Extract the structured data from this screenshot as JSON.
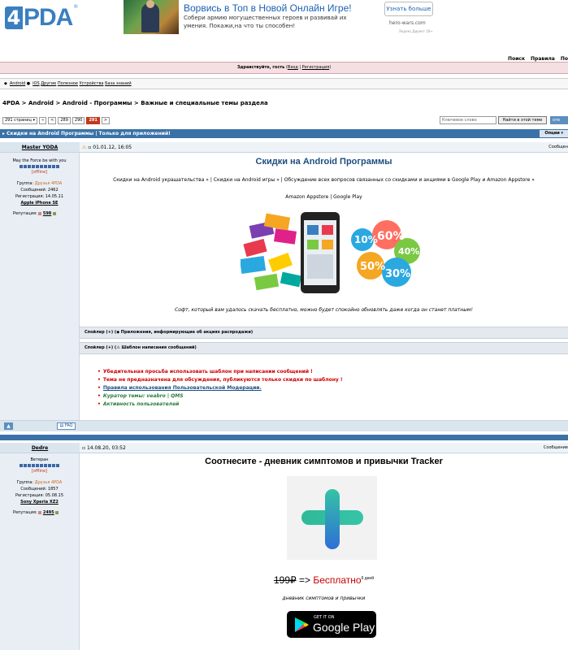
{
  "header": {
    "logo_text": "PDA",
    "logo_number": "4",
    "ad": {
      "title": "Ворвись в Топ в Новой Онлайн Игре!",
      "body": "Собери армию могущественных героев и развивай их умения. Покажи,на что ты способен!",
      "button": "Узнать больше",
      "domain": "hero-wars.com",
      "note": "Яндекс.Директ 18+"
    },
    "nav": [
      "Поиск",
      "Правила",
      "По"
    ]
  },
  "welcome": {
    "greeting": "Здравствуйте, гость",
    "login": "Вход",
    "sep": " | ",
    "register": "Регистрация"
  },
  "platforms": [
    "Android",
    "iOS",
    "Другие",
    "Полезное",
    "Устройства",
    "База знаний"
  ],
  "breadcrumbs": "4PDA > Android > Android - Программы > Важные и специальные темы раздела",
  "pager": {
    "total": "291 страниц",
    "items": [
      "«",
      "<",
      "289",
      "290",
      "291",
      ">"
    ]
  },
  "search": {
    "placeholder": "Ключевое слово",
    "button": "Найти в этой теме",
    "extra": "отв"
  },
  "topic": {
    "title": "Скидки на Android Программы | Только для приложений!",
    "options": "Опции"
  },
  "post1": {
    "user": {
      "name": "Master YODA",
      "status": "May the Force be with you",
      "online": "[offline]",
      "group_label": "Группа:",
      "group": "Друзья 4PDA",
      "messages": "Сообщений: 2462",
      "registered": "Регистрация: 14.05.11",
      "device": "Apple iPhone SE",
      "rep_label": "Репутация:",
      "rep": "598"
    },
    "date": "01.01.12, 16:05",
    "label": "Сообщен",
    "title": "Скидки на Android Программы",
    "links": "Скидки на Android украшательства » | Скидки на Android игры » | Обсуждение всех вопросов связанных со скидками и акциями в Google Play и Amazon Appstore »",
    "stores": "Amazon Appstore | Google Play",
    "caption": "Софт, который вам удалось скачать бесплатно, можно будет спокойно обновлять даже когда он станет платным!",
    "spoiler1": "Спойлер (+) (◆ Приложения, информирующие об акциях распродажи)",
    "spoiler2": "Спойлер (+) (⚠ Шаблон написания сообщений)",
    "rules": [
      "Убедительная просьба использовать шаблон при написании сообщений !",
      "Тема не предназначена для обсуждения, публикуются только скидки по шаблону !",
      "Правила использования Пользовательской Модерации.",
      "Куратор темы: veabro | QMS",
      "Активность пользователей"
    ],
    "faq": "FAQ"
  },
  "post2": {
    "user": {
      "name": "Dedre",
      "status": "Ветеран",
      "online": "[offline]",
      "group_label": "Группа:",
      "group": "Друзья 4PDA",
      "messages": "Сообщений: 1857",
      "registered": "Регистрация: 05.08.15",
      "device": "Sony Xperia XZ2",
      "rep_label": "Репутация:",
      "rep": "2495"
    },
    "date": "14.08.20, 03:52",
    "label": "Сообщение",
    "title": "Соотнесите - дневник симптомов и привычки Tracker",
    "old_price": "199₽",
    "arrow": " => ",
    "free": "Бесплатно",
    "days": "6 дней",
    "subtitle": "дневник симптомов и привычки",
    "gp_small": "GET IT ON",
    "gp_big": "Google Play"
  },
  "colors": {
    "brand_blue": "#3a7fbf",
    "bar_blue": "#3a72a8",
    "red": "#c00000"
  }
}
